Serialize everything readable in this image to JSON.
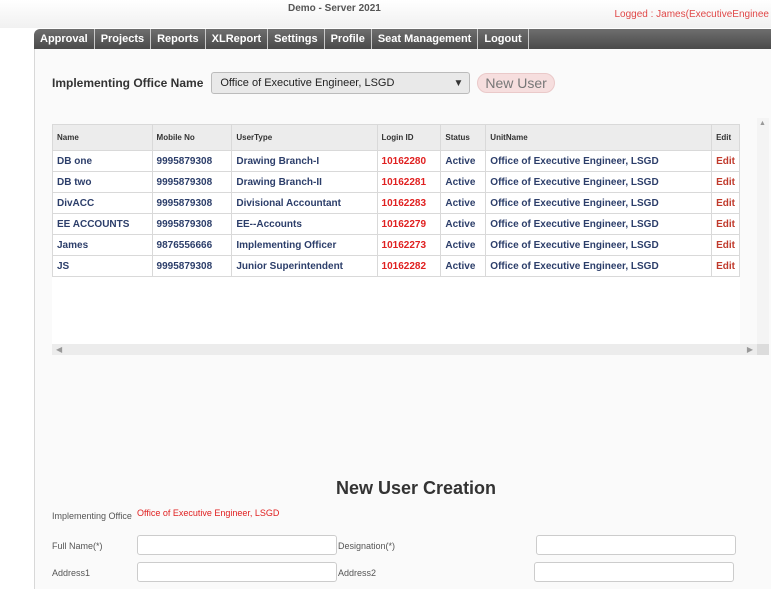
{
  "header": {
    "server_label": "Demo - Server 2021",
    "logged_in": "Logged : James(ExecutiveEnginee"
  },
  "menu": {
    "items": [
      "Approval",
      "Projects",
      "Reports",
      "XLReport",
      "Settings",
      "Profile",
      "Seat Management",
      "Logout"
    ]
  },
  "office": {
    "label": "Implementing Office Name",
    "selected": "Office of Executive Engineer, LSGD",
    "new_user_label": "New User"
  },
  "table": {
    "headers": [
      "Name",
      "Mobile No",
      "UserType",
      "Login ID",
      "Status",
      "UnitName",
      "Edit"
    ],
    "rows": [
      [
        "DB one",
        "9995879308",
        "Drawing Branch-I",
        "10162280",
        "Active",
        "Office of Executive Engineer, LSGD",
        "Edit"
      ],
      [
        "DB two",
        "9995879308",
        "Drawing Branch-II",
        "10162281",
        "Active",
        "Office of Executive Engineer, LSGD",
        "Edit"
      ],
      [
        "DivACC",
        "9995879308",
        "Divisional Accountant",
        "10162283",
        "Active",
        "Office of Executive Engineer, LSGD",
        "Edit"
      ],
      [
        "EE ACCOUNTS",
        "9995879308",
        "EE--Accounts",
        "10162279",
        "Active",
        "Office of Executive Engineer, LSGD",
        "Edit"
      ],
      [
        "James",
        "9876556666",
        "Implementing Officer",
        "10162273",
        "Active",
        "Office of Executive Engineer, LSGD",
        "Edit"
      ],
      [
        "JS",
        "9995879308",
        "Junior Superintendent",
        "10162282",
        "Active",
        "Office of Executive Engineer, LSGD",
        "Edit"
      ]
    ]
  },
  "form": {
    "title": "New User Creation",
    "implementing_office_label": "Implementing Office",
    "implementing_office_value": "Office of Executive Engineer, LSGD",
    "full_name_label": "Full Name(*)",
    "designation_label": "Designation(*)",
    "address1_label": "Address1",
    "address2_label": "Address2"
  },
  "colors": {
    "menu_bg": "#5a5a5a",
    "accent_red": "#e02020",
    "row_text": "#2c3e6a",
    "new_user_bg": "#f6dede"
  }
}
